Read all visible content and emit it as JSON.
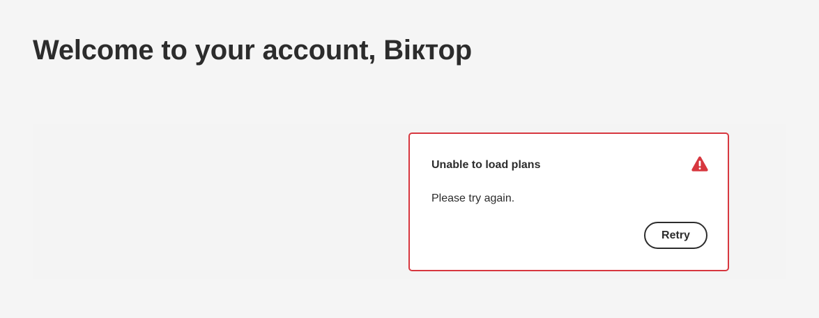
{
  "header": {
    "welcome_title": "Welcome to your account, Віктор"
  },
  "plans_alert": {
    "heading": "Unable to load plans",
    "message": "Please try again.",
    "retry_label": "Retry",
    "icon": "alert-triangle-icon",
    "accent_color": "#d7373f"
  }
}
